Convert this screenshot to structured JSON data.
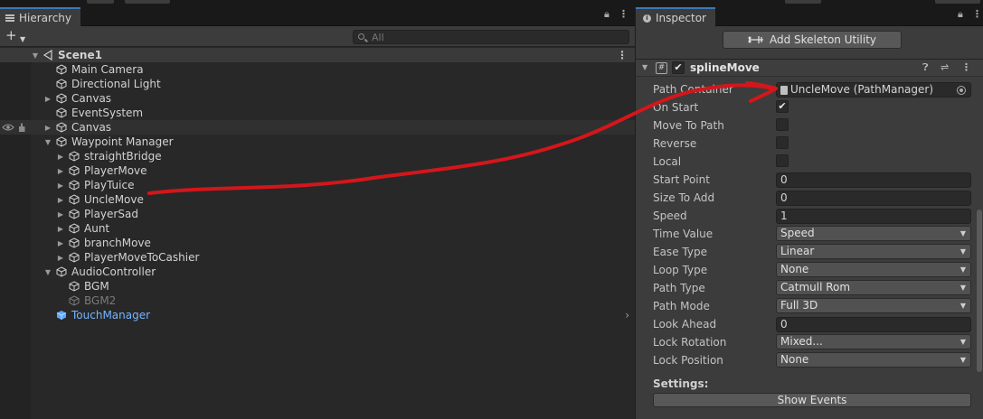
{
  "hierarchy": {
    "tab_label": "Hierarchy",
    "search_placeholder": "All",
    "rows": [
      {
        "label": "Scene1"
      },
      {
        "label": "Main Camera"
      },
      {
        "label": "Directional Light"
      },
      {
        "label": "Canvas"
      },
      {
        "label": "EventSystem"
      },
      {
        "label": "Canvas"
      },
      {
        "label": "Waypoint Manager"
      },
      {
        "label": "straightBridge"
      },
      {
        "label": "PlayerMove"
      },
      {
        "label": "PlayTuice"
      },
      {
        "label": "UncleMove"
      },
      {
        "label": "PlayerSad"
      },
      {
        "label": "Aunt"
      },
      {
        "label": "branchMove"
      },
      {
        "label": "PlayerMoveToCashier"
      },
      {
        "label": "AudioController"
      },
      {
        "label": "BGM"
      },
      {
        "label": "BGM2"
      },
      {
        "label": "TouchManager"
      }
    ]
  },
  "inspector": {
    "tab_label": "Inspector",
    "add_skeleton_button": "Add Skeleton Utility",
    "component_title": "splineMove",
    "properties": [
      {
        "label": "Path Container",
        "value": "UncleMove (PathManager)"
      },
      {
        "label": "On Start",
        "value": "✔"
      },
      {
        "label": "Move To Path",
        "value": ""
      },
      {
        "label": "Reverse",
        "value": ""
      },
      {
        "label": "Local",
        "value": ""
      },
      {
        "label": "Start Point",
        "value": "0"
      },
      {
        "label": "Size To Add",
        "value": "0"
      },
      {
        "label": "Speed",
        "value": "1"
      },
      {
        "label": "Time Value",
        "value": "Speed"
      },
      {
        "label": "Ease Type",
        "value": "Linear"
      },
      {
        "label": "Loop Type",
        "value": "None"
      },
      {
        "label": "Path Type",
        "value": "Catmull Rom"
      },
      {
        "label": "Path Mode",
        "value": "Full 3D"
      },
      {
        "label": "Look Ahead",
        "value": "0"
      },
      {
        "label": "Lock Rotation",
        "value": "Mixed..."
      },
      {
        "label": "Lock Position",
        "value": "None"
      }
    ],
    "settings_label": "Settings:",
    "show_events_button": "Show Events"
  },
  "colors": {
    "accent_tab": "#3a79bb",
    "prefab_blue": "#74b4ff",
    "annotation_red": "#d4161b"
  }
}
